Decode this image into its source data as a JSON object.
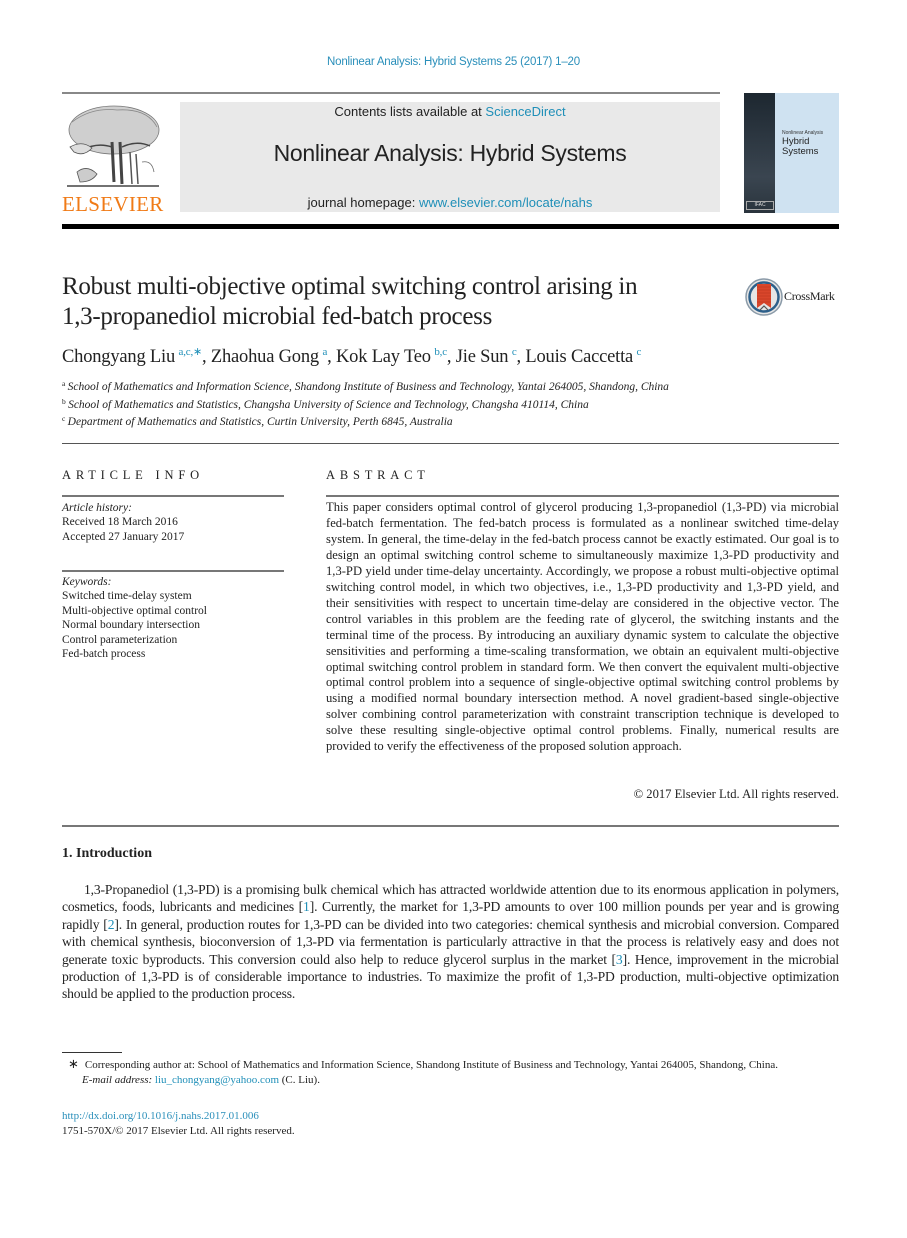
{
  "running_head": "Nonlinear Analysis: Hybrid Systems 25 (2017) 1–20",
  "masthead": {
    "publisher_logo_word": "ELSEVIER",
    "contents_prefix": "Contents lists available at ",
    "contents_link": "ScienceDirect",
    "journal_name": "Nonlinear Analysis: Hybrid Systems",
    "homepage_prefix": "journal homepage: ",
    "homepage_link": "www.elsevier.com/locate/nahs",
    "cover": {
      "subtitle": "Nonlinear Analysis",
      "title_line1": "Hybrid",
      "title_line2": "Systems",
      "badge": "IFAC"
    }
  },
  "article": {
    "title_line1": "Robust multi-objective optimal switching control arising in",
    "title_line2": "1,3-propanediol microbial fed-batch process",
    "crossmark_label": "CrossMark",
    "authors": [
      {
        "name": "Chongyang Liu",
        "sup": "a,c,∗",
        "sep": ", "
      },
      {
        "name": "Zhaohua Gong",
        "sup": "a",
        "sep": ", "
      },
      {
        "name": "Kok Lay Teo",
        "sup": "b,c",
        "sep": ", "
      },
      {
        "name": "Jie Sun",
        "sup": "c",
        "sep": ", "
      },
      {
        "name": "Louis Caccetta",
        "sup": "c",
        "sep": ""
      }
    ],
    "affiliations": [
      {
        "mark": "a",
        "text": "School of Mathematics and Information Science, Shandong Institute of Business and Technology, Yantai 264005, Shandong, China"
      },
      {
        "mark": "b",
        "text": "School of Mathematics and Statistics, Changsha University of Science and Technology, Changsha 410114, China"
      },
      {
        "mark": "c",
        "text": "Department of Mathematics and Statistics, Curtin University, Perth 6845, Australia"
      }
    ]
  },
  "article_info": {
    "heading": "ARTICLE INFO",
    "history_label": "Article history:",
    "received": "Received 18 March 2016",
    "accepted": "Accepted 27 January 2017",
    "keywords_label": "Keywords:",
    "keywords": [
      "Switched time-delay system",
      "Multi-objective optimal control",
      "Normal boundary intersection",
      "Control parameterization",
      "Fed-batch process"
    ]
  },
  "abstract": {
    "heading": "ABSTRACT",
    "text": "This paper considers optimal control of glycerol producing 1,3-propanediol (1,3-PD) via microbial fed-batch fermentation. The fed-batch process is formulated as a nonlinear switched time-delay system. In general, the time-delay in the fed-batch process cannot be exactly estimated. Our goal is to design an optimal switching control scheme to simultaneously maximize 1,3-PD productivity and 1,3-PD yield under time-delay uncertainty. Accordingly, we propose a robust multi-objective optimal switching control model, in which two objectives, i.e., 1,3-PD productivity and 1,3-PD yield, and their sensitivities with respect to uncertain time-delay are considered in the objective vector. The control variables in this problem are the feeding rate of glycerol, the switching instants and the terminal time of the process. By introducing an auxiliary dynamic system to calculate the objective sensitivities and performing a time-scaling transformation, we obtain an equivalent multi-objective optimal switching control problem in standard form. We then convert the equivalent multi-objective optimal control problem into a sequence of single-objective optimal switching control problems by using a modified normal boundary intersection method. A novel gradient-based single-objective solver combining control parameterization with constraint transcription technique is developed to solve these resulting single-objective optimal control problems. Finally, numerical results are provided to verify the effectiveness of the proposed solution approach.",
    "copyright": "© 2017 Elsevier Ltd. All rights reserved."
  },
  "introduction": {
    "heading": "1.  Introduction",
    "segments": [
      {
        "t": "1,3-Propanediol (1,3-PD) is a promising bulk chemical which has attracted worldwide attention due to its enormous application in polymers, cosmetics, foods, lubricants and medicines [",
        "link": false
      },
      {
        "t": "1",
        "link": true
      },
      {
        "t": "]. Currently, the market for 1,3-PD amounts to over 100 million pounds per year and is growing rapidly [",
        "link": false
      },
      {
        "t": "2",
        "link": true
      },
      {
        "t": "]. In general, production routes for 1,3-PD can be divided into two categories: chemical synthesis and microbial conversion. Compared with chemical synthesis, bioconversion of 1,3-PD via fermentation is particularly attractive in that the process is relatively easy and does not generate toxic byproducts. This conversion could also help to reduce glycerol surplus in the market [",
        "link": false
      },
      {
        "t": "3",
        "link": true
      },
      {
        "t": "]. Hence, improvement in the microbial production of 1,3-PD is of considerable importance to industries. To maximize the profit of 1,3-PD production, multi-objective optimization should be applied to the production process.",
        "link": false
      }
    ]
  },
  "footnotes": {
    "star": "∗",
    "corresponding": "Corresponding author at: School of Mathematics and Information Science, Shandong Institute of Business and Technology, Yantai 264005, Shandong, China.",
    "email_label": "E-mail address: ",
    "email": "liu_chongyang@yahoo.com",
    "email_suffix": " (C. Liu).",
    "doi": "http://dx.doi.org/10.1016/j.nahs.2017.01.006",
    "issn": "1751-570X/© 2017 Elsevier Ltd. All rights reserved."
  },
  "colors": {
    "link": "#1f8fb8",
    "elsevier_orange": "#f07a16",
    "masthead_bg": "#e9e9e9"
  }
}
